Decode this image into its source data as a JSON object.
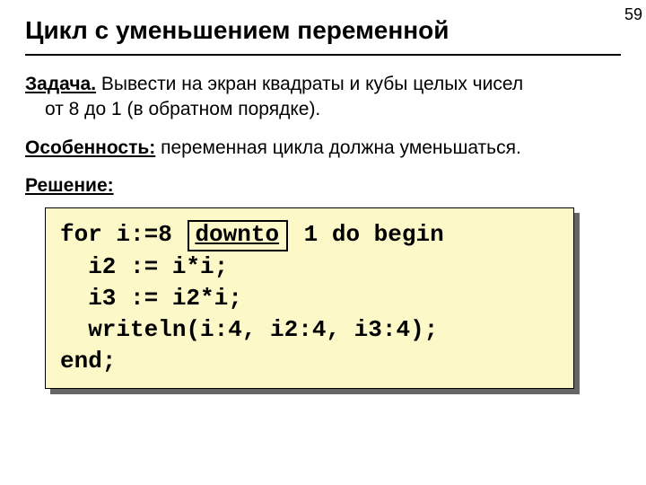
{
  "page_number": "59",
  "title": "Цикл с уменьшением переменной",
  "task_label": "Задача.",
  "task_text_1": " Вывести на экран квадраты и кубы целых чисел",
  "task_text_2": "от 8 до 1 (в обратном порядке).",
  "feature_label": "Особенность:",
  "feature_text": " переменная цикла должна уменьшаться.",
  "solution_label": "Решение:",
  "code": {
    "l1a": "for i:=8 ",
    "keyword": "downto",
    "l1b": " 1 do begin",
    "l2": "  i2 := i*i;",
    "l3": "  i3 := i2*i;",
    "l4": "  writeln(i:4, i2:4, i3:4);",
    "l5": "end;"
  }
}
